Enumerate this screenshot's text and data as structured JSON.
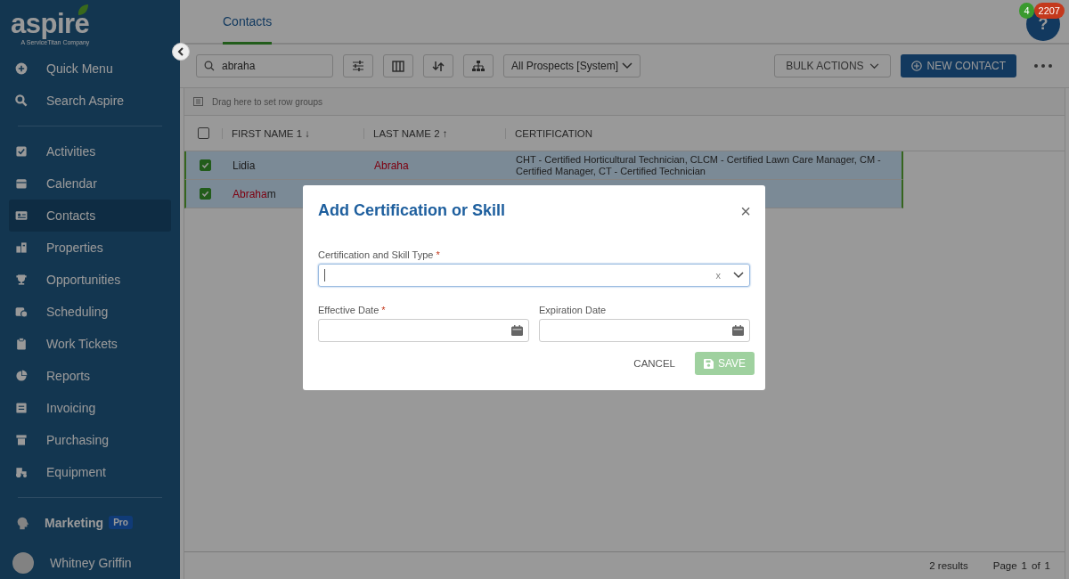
{
  "sidebar": {
    "logo": {
      "wordmark": "aspire",
      "tagline": "A ServiceTitan Company"
    },
    "top_items": [
      {
        "label": "Quick Menu"
      },
      {
        "label": "Search Aspire"
      }
    ],
    "items": [
      {
        "label": "Activities",
        "selected": false
      },
      {
        "label": "Calendar",
        "selected": false
      },
      {
        "label": "Contacts",
        "selected": true
      },
      {
        "label": "Properties",
        "selected": false
      },
      {
        "label": "Opportunities",
        "selected": false
      },
      {
        "label": "Scheduling",
        "selected": false
      },
      {
        "label": "Work Tickets",
        "selected": false
      },
      {
        "label": "Reports",
        "selected": false
      },
      {
        "label": "Invoicing",
        "selected": false
      },
      {
        "label": "Purchasing",
        "selected": false
      },
      {
        "label": "Equipment",
        "selected": false
      }
    ],
    "marketing": {
      "label": "Marketing",
      "badge": "Pro"
    },
    "user": {
      "name": "Whitney Griffin"
    }
  },
  "tabs": [
    {
      "label": "Contacts",
      "selected": true
    }
  ],
  "help": {
    "icon": "?",
    "badges": [
      {
        "text": "4",
        "color": "#3a9a2e"
      },
      {
        "text": "2207",
        "color": "#c4391d"
      }
    ]
  },
  "toolbar": {
    "search": {
      "value": "abraha"
    },
    "view": {
      "value": "All Prospects [System]"
    },
    "bulk_actions": "BULK ACTIONS",
    "new_contact": "NEW CONTACT"
  },
  "grid": {
    "group_hint": "Drag here to set row groups",
    "header_checked": false,
    "columns": [
      "FIRST NAME 1 ↓",
      "LAST NAME 2 ↑",
      "CERTIFICATION"
    ],
    "rows": [
      {
        "selected": true,
        "cells": [
          [
            {
              "text": "Lidia",
              "match": false
            }
          ],
          [
            {
              "text": "Abraha",
              "match": true
            }
          ],
          [
            {
              "text": "CHT - Certified Horticultural Technician, CLCM - Certified Lawn Care Manager, CM - Certified Manager, CT - Certified Technician",
              "match": false
            }
          ]
        ]
      },
      {
        "selected": true,
        "cells": [
          [
            {
              "text": "Abraha",
              "match": true
            },
            {
              "text": "m",
              "match": false
            }
          ]
        ]
      }
    ],
    "footer": {
      "results": "2 results",
      "page_label": "Page",
      "page": "1",
      "of": "of",
      "pages": "1"
    }
  },
  "dialog": {
    "title": "Add Certification or Skill",
    "close": "×",
    "type_field": {
      "label": "Certification and Skill Type",
      "required_mark": "*",
      "clear": "x"
    },
    "effective": {
      "label": "Effective Date",
      "required_mark": "*"
    },
    "expiration": {
      "label": "Expiration Date"
    },
    "cancel": "CANCEL",
    "save": {
      "label": "SAVE",
      "disabled": true
    }
  }
}
